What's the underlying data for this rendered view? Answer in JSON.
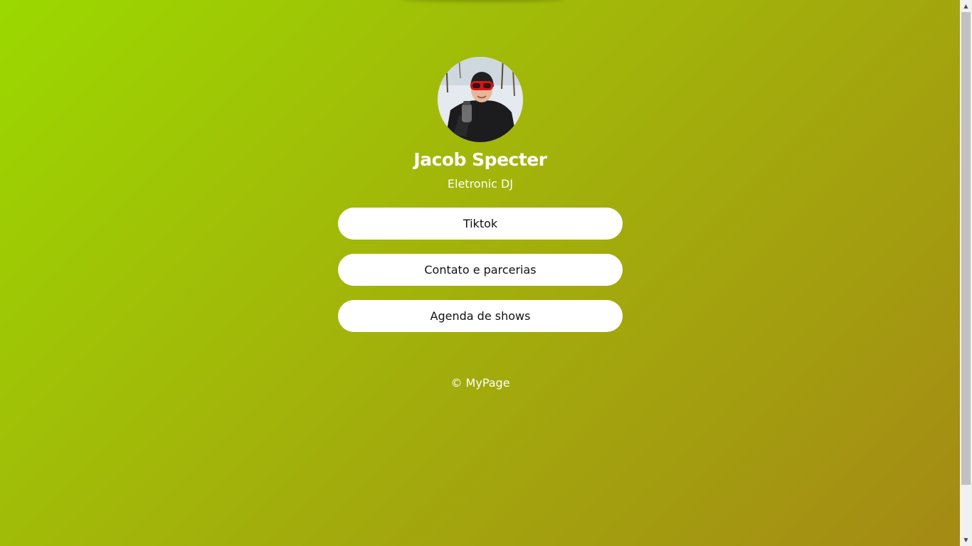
{
  "profile": {
    "name": "Jacob Specter",
    "subtitle": "Eletronic DJ",
    "avatar_icon": "profile-photo"
  },
  "links": [
    {
      "label": "Tiktok"
    },
    {
      "label": "Contato e parcerias"
    },
    {
      "label": "Agenda de shows"
    }
  ],
  "footer": {
    "text": "© MyPage"
  },
  "colors": {
    "gradient_start": "#9bd800",
    "gradient_end": "#a48a14",
    "button_bg": "#ffffff",
    "text_light": "#ffffff"
  }
}
